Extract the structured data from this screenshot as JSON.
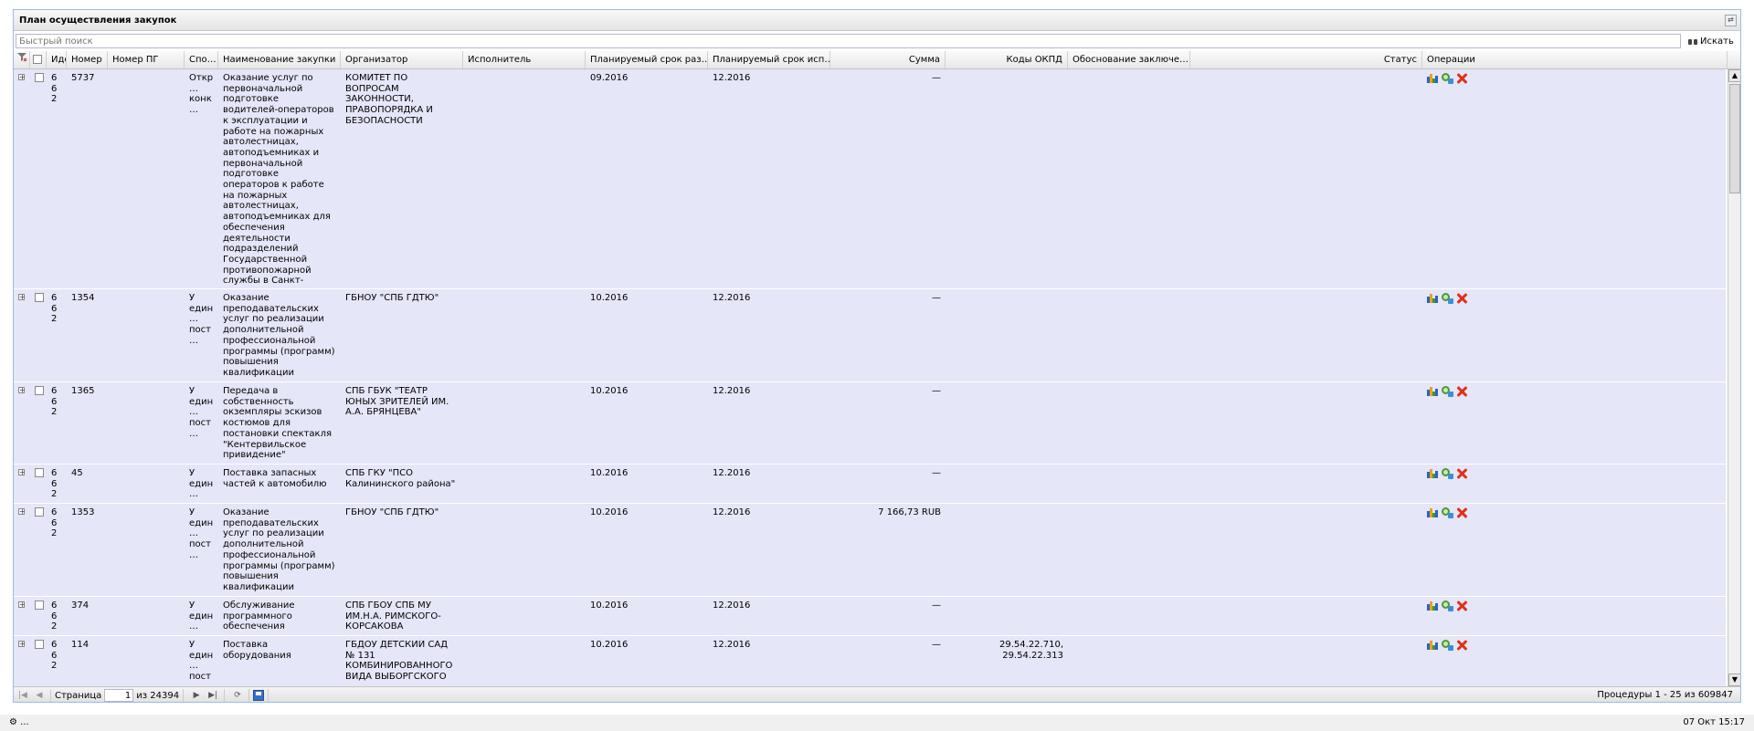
{
  "panel": {
    "title": "План осуществления закупок"
  },
  "search": {
    "placeholder": "Быстрый поиск",
    "button_label": "Искать"
  },
  "columns": [
    {
      "key": "id",
      "label": "Иде"
    },
    {
      "key": "number",
      "label": "Номер"
    },
    {
      "key": "pg_number",
      "label": "Номер ПГ"
    },
    {
      "key": "method",
      "label": "Спо…"
    },
    {
      "key": "name",
      "label": "Наименование закупки"
    },
    {
      "key": "organizer",
      "label": "Организатор"
    },
    {
      "key": "executor",
      "label": "Исполнитель"
    },
    {
      "key": "planned_post",
      "label": "Планируемый срок раз…"
    },
    {
      "key": "planned_exec",
      "label": "Планируемый срок исп…"
    },
    {
      "key": "sum",
      "label": "Сумма"
    },
    {
      "key": "okpd",
      "label": "Коды ОКПД"
    },
    {
      "key": "justification",
      "label": "Обоснование заключе…"
    },
    {
      "key": "status",
      "label": "Статус"
    },
    {
      "key": "operations",
      "label": "Операции"
    }
  ],
  "rows": [
    {
      "id": "662",
      "number": "5737",
      "pg_number": "",
      "method": "Откр… конк…",
      "name": "Оказание услуг по первоначальной подготовке водителей-операторов к эксплуатации и работе на пожарных автолестницах, автоподъемниках и первоначальной подготовке операторов к работе на пожарных автолестницах, автоподъемниках для обеспечения деятельности подразделений Государственной противопожарной службы в Санкт-Петербурге",
      "organizer": "КОМИТЕТ ПО ВОПРОСАМ ЗАКОННОСТИ, ПРАВОПОРЯДКА И БЕЗОПАСНОСТИ",
      "executor": "",
      "planned_post": "09.2016",
      "planned_exec": "12.2016",
      "sum": "—",
      "okpd": "",
      "justification": "",
      "status": ""
    },
    {
      "id": "662",
      "number": "1354",
      "pg_number": "",
      "method": "У един… пост…",
      "name": "Оказание преподавательских услуг по реализации дополнительной профессиональной программы (программ) повышения квалификации",
      "organizer": "ГБНОУ \"СПБ ГДТЮ\"",
      "executor": "",
      "planned_post": "10.2016",
      "planned_exec": "12.2016",
      "sum": "—",
      "okpd": "",
      "justification": "",
      "status": ""
    },
    {
      "id": "662",
      "number": "1365",
      "pg_number": "",
      "method": "У един… пост…",
      "name": "Передача в собственность окземпляры эскизов костюмов для постановки спектакля \"Кентервильское привидение\"",
      "organizer": "СПБ ГБУК \"ТЕАТР ЮНЫХ ЗРИТЕЛЕЙ ИМ. А.А. БРЯНЦЕВА\"",
      "executor": "",
      "planned_post": "10.2016",
      "planned_exec": "12.2016",
      "sum": "—",
      "okpd": "",
      "justification": "",
      "status": ""
    },
    {
      "id": "662",
      "number": "45",
      "pg_number": "",
      "method": "У един… пост…",
      "name": "Поставка запасных частей к автомобилю",
      "organizer": "СПБ ГКУ \"ПСО Калининского района\"",
      "executor": "",
      "planned_post": "10.2016",
      "planned_exec": "12.2016",
      "sum": "—",
      "okpd": "",
      "justification": "",
      "status": ""
    },
    {
      "id": "662",
      "number": "1353",
      "pg_number": "",
      "method": "У един… пост…",
      "name": "Оказание преподавательских услуг по реализации дополнительной профессиональной программы (программ) повышения квалификации",
      "organizer": "ГБНОУ \"СПБ ГДТЮ\"",
      "executor": "",
      "planned_post": "10.2016",
      "planned_exec": "12.2016",
      "sum": "7 166,73 RUB",
      "okpd": "",
      "justification": "",
      "status": ""
    },
    {
      "id": "662",
      "number": "374",
      "pg_number": "",
      "method": "У един… пост…",
      "name": "Обслуживание программного обеспечения",
      "organizer": "СПБ ГБОУ СПБ МУ ИМ.Н.А. РИМСКОГО-КОРСАКОВА",
      "executor": "",
      "planned_post": "10.2016",
      "planned_exec": "12.2016",
      "sum": "—",
      "okpd": "",
      "justification": "",
      "status": ""
    },
    {
      "id": "662",
      "number": "114",
      "pg_number": "",
      "method": "У един… пост…",
      "name": "Поставка оборудования",
      "organizer": "ГБДОУ ДЕТСКИЙ САД № 131 КОМБИНИРОВАННОГО ВИДА ВЫБОРГСКОГО",
      "executor": "",
      "planned_post": "10.2016",
      "planned_exec": "12.2016",
      "sum": "—",
      "okpd": "29.54.22.710, 29.54.22.313",
      "justification": "",
      "status": ""
    }
  ],
  "pager": {
    "page_label": "Страница",
    "page_value": "1",
    "of_label": "из 24394",
    "summary": "Процедуры 1 - 25 из 609847"
  },
  "statusbar": {
    "left": "⚙ ...",
    "right": "07 Окт 15:17"
  },
  "icons": {
    "chart": "stats-chart-icon",
    "gear": "settings-gear-icon",
    "delete": "delete-x-icon",
    "search": "binoculars-icon",
    "save": "floppy-disk-icon"
  }
}
